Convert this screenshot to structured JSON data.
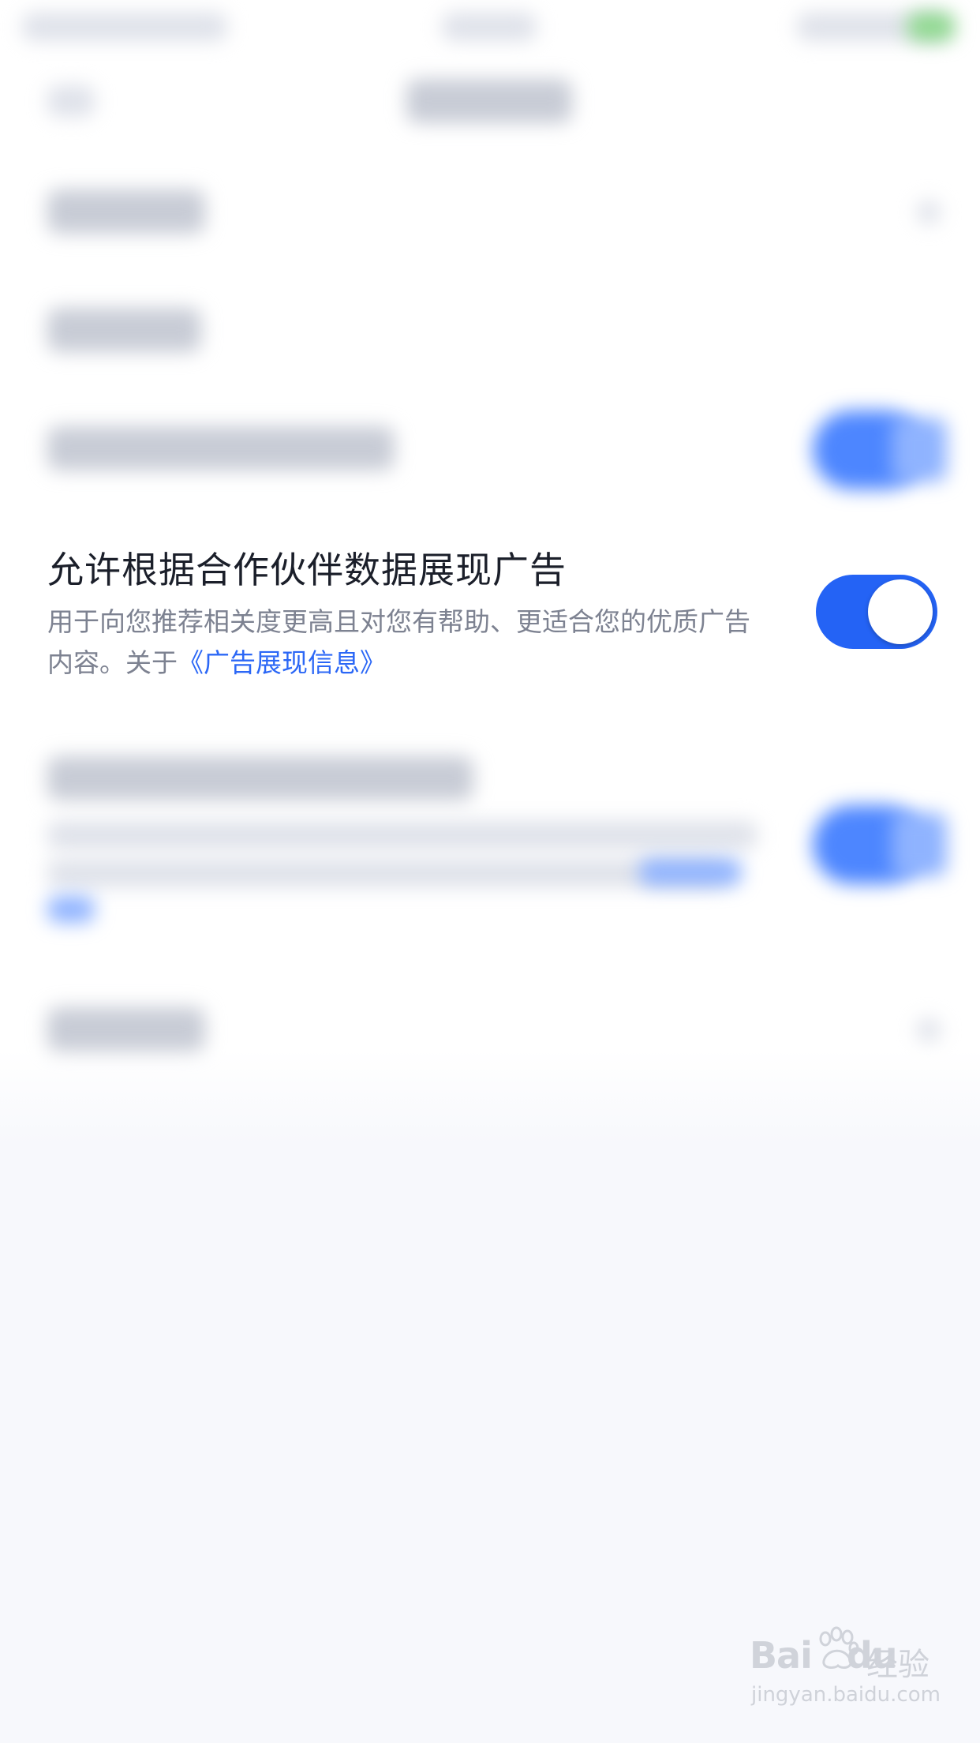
{
  "setting": {
    "title": "允许根据合作伙伴数据展现广告",
    "description_text": "用于向您推荐相关度更高且对您有帮助、更适合您的优质广告内容。关于",
    "description_link": "《广告展现信息》",
    "toggle_on": true
  },
  "colors": {
    "accent": "#2463f5",
    "link": "#2b67f6",
    "title": "#1b1f2a",
    "description": "#7d8291",
    "background": "#f7f8fc"
  },
  "watermark": {
    "logo_left": "Bai",
    "logo_right": "du",
    "chinese": "经验",
    "url": "jingyan.baidu.com"
  }
}
